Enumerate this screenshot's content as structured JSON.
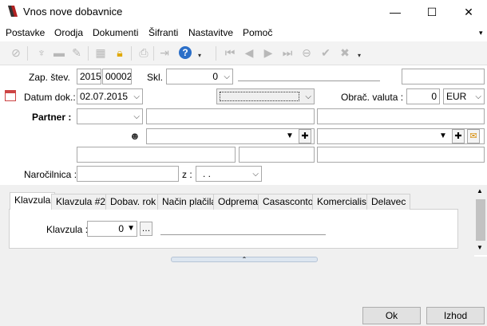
{
  "window": {
    "title": "Vnos nove dobavnice",
    "minimize_glyph": "—",
    "maximize_glyph": "☐",
    "close_glyph": "✕"
  },
  "menu": {
    "items": [
      "Postavke",
      "Orodja",
      "Dokumenti",
      "Šifranti",
      "Nastavitve",
      "Pomoč"
    ],
    "overflow_glyph": "▾"
  },
  "toolbar": {
    "icons": [
      "cancel-icon",
      "pin-icon",
      "folder-icon",
      "edit-icon",
      "calculator-icon",
      "lock-icon",
      "print-icon",
      "export-icon",
      "help-icon",
      "first-icon",
      "prev-icon",
      "next-icon",
      "last-icon",
      "up-icon",
      "confirm-icon",
      "delete-icon"
    ]
  },
  "form": {
    "zap_stev_label": "Zap. štev.",
    "zap_year": "2015",
    "zap_number": "00002",
    "skl_label": "Skl.",
    "skl_value": "0",
    "datum_label": "Datum dok.:",
    "datum_value": "02.07.2015",
    "obrac_label": "Obrač. valuta :",
    "obrac_value": "0",
    "currency": "EUR",
    "partner_label": "Partner :",
    "narocilnica_label": "Naročilnica :",
    "z_label": "z :",
    "z_value": ". ."
  },
  "tabs": [
    "Klavzula",
    "Klavzula #2",
    "Dobav. rok",
    "Način plačila",
    "Odprema",
    "Casasconto",
    "Komercialist",
    "Delavec"
  ],
  "tab_content": {
    "klavzula_label": "Klavzula :",
    "klavzula_value": "0",
    "ellipsis": "…"
  },
  "buttons": {
    "ok": "Ok",
    "izhod": "Izhod"
  },
  "colors": {
    "accent_help": "#2b6fc8",
    "lock": "#e0a800"
  }
}
